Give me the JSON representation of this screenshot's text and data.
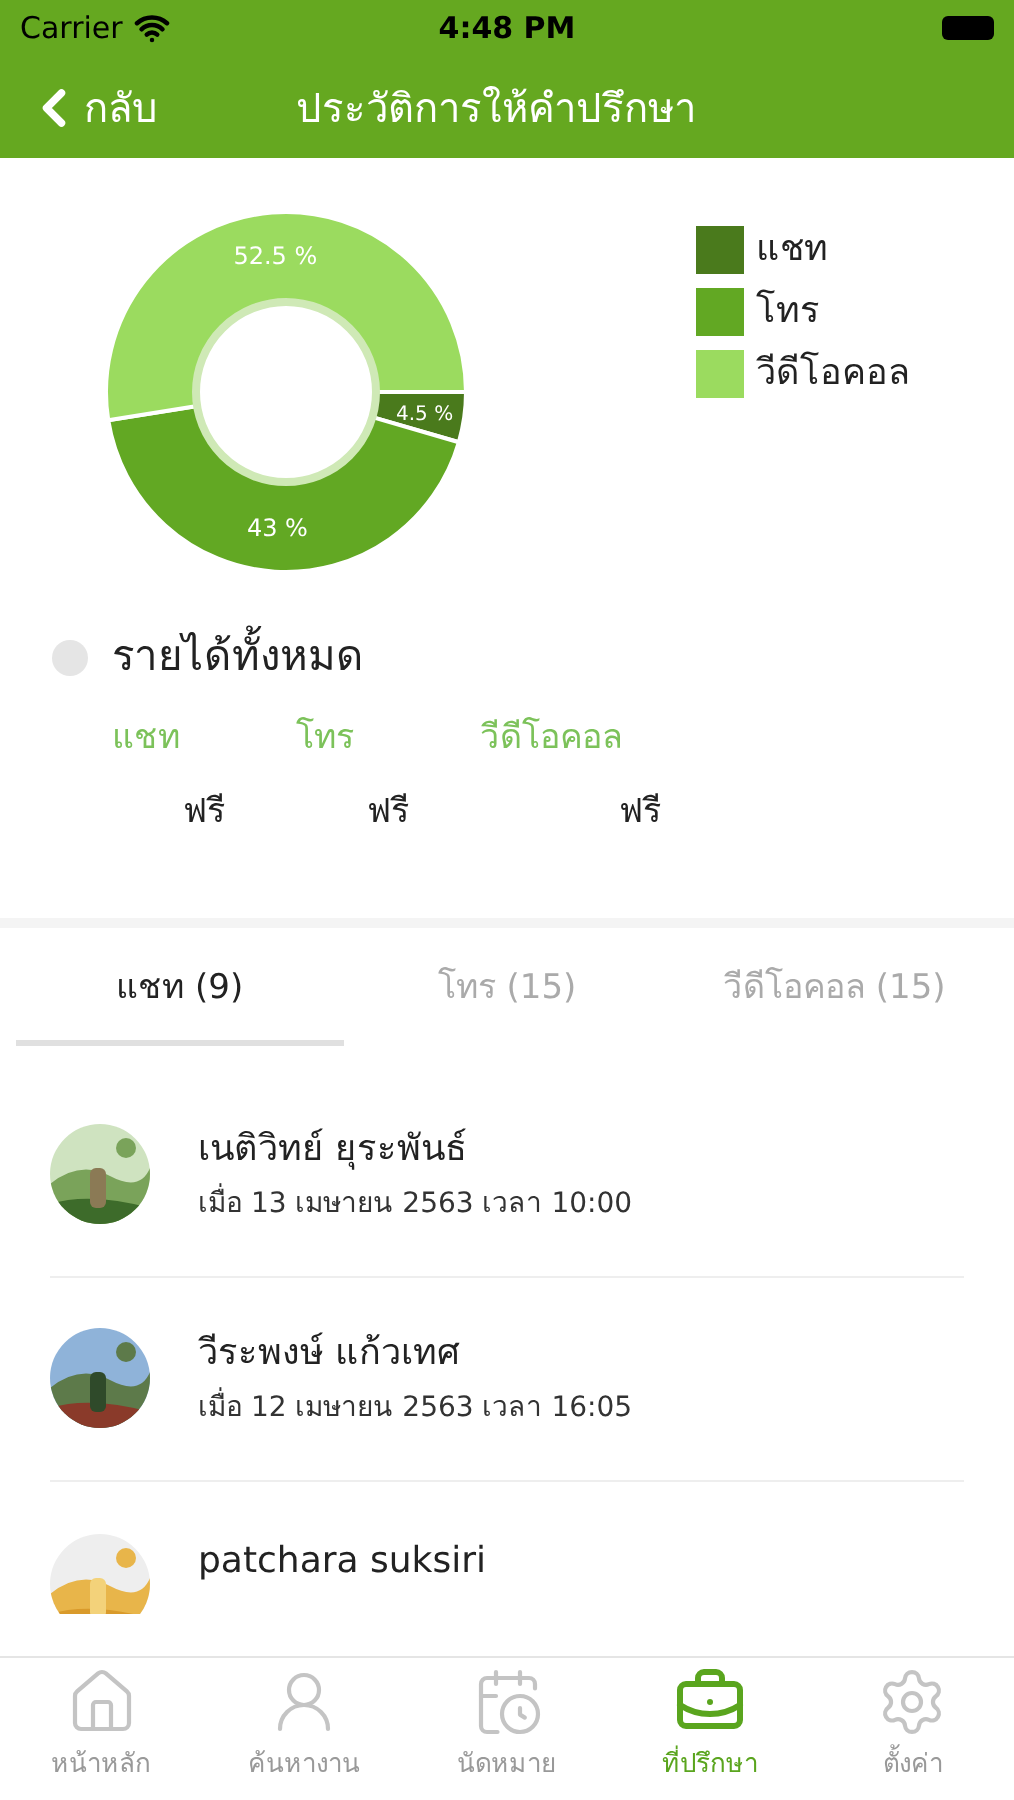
{
  "status_bar": {
    "carrier": "Carrier",
    "time": "4:48 PM"
  },
  "nav": {
    "back": "กลับ",
    "title": "ประวัติการให้คำปรึกษา"
  },
  "chart": {
    "chart_data": {
      "type": "donut",
      "categories": [
        "แชท",
        "โทร",
        "วีดีโอคอล"
      ],
      "values": [
        4.5,
        43,
        52.5
      ],
      "value_labels": [
        "4.5 %",
        "43 %",
        "52.5 %"
      ]
    },
    "legend": [
      {
        "color": "#4a7a1c"
      },
      {
        "color": "#62a823"
      },
      {
        "color": "#9bdb5f"
      }
    ]
  },
  "income": {
    "title": "รายได้ทั้งหมด",
    "columns": [
      {
        "label": "แชท",
        "value": "ฟรี"
      },
      {
        "label": "โทร",
        "value": "ฟรี"
      },
      {
        "label": "วีดีโอคอล",
        "value": "ฟรี"
      }
    ]
  },
  "tabs": [
    {
      "label": "แชท (9)",
      "selected": true
    },
    {
      "label": "โทร (15)",
      "selected": false
    },
    {
      "label": "วีดีโอคอล (15)",
      "selected": false
    }
  ],
  "items": [
    {
      "name": "เนติวิทย์ ยุระพันธ์",
      "when": "เมื่อ 13 เมษายน 2563 เวลา 10:00",
      "kind": "picture"
    },
    {
      "name": "วีระพงษ์ แก้วเทศ",
      "when": "เมื่อ 12 เมษายน 2563 เวลา 16:05",
      "kind": "picture"
    },
    {
      "name": "patchara suksiri",
      "kind": "picture"
    }
  ],
  "tab_bar": [
    {
      "label": "หน้าหลัก",
      "kind": "home",
      "selected": false
    },
    {
      "label": "ค้นหางาน",
      "kind": "person",
      "selected": false
    },
    {
      "label": "นัดหมาย",
      "kind": "calendar",
      "selected": false
    },
    {
      "label": "ที่ปรึกษา",
      "kind": "briefcase",
      "selected": true
    },
    {
      "label": "ตั้งค่า",
      "kind": "settings",
      "selected": false
    }
  ]
}
